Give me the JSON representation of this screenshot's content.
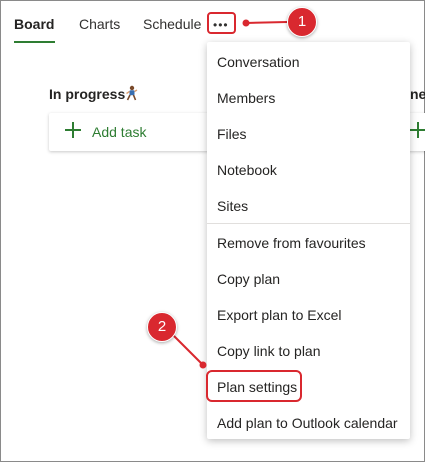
{
  "tabs": [
    {
      "label": "Board",
      "active": true
    },
    {
      "label": "Charts",
      "active": false
    },
    {
      "label": "Schedule",
      "active": false
    }
  ],
  "more_button": {
    "icon": "ellipsis-icon"
  },
  "bucket": {
    "title": "In progress",
    "emoji": "person-running-emoji",
    "add_task_label": "Add task"
  },
  "partial_bucket": {
    "title_fragment": "ne"
  },
  "menu": {
    "items": [
      "Conversation",
      "Members",
      "Files",
      "Notebook",
      "Sites",
      "Remove from favourites",
      "Copy plan",
      "Export plan to Excel",
      "Copy link to plan",
      "Plan settings",
      "Add plan to Outlook calendar"
    ]
  },
  "callouts": [
    "1",
    "2"
  ],
  "colors": {
    "accent": "#2e7d32",
    "annotation": "#d9282f"
  }
}
